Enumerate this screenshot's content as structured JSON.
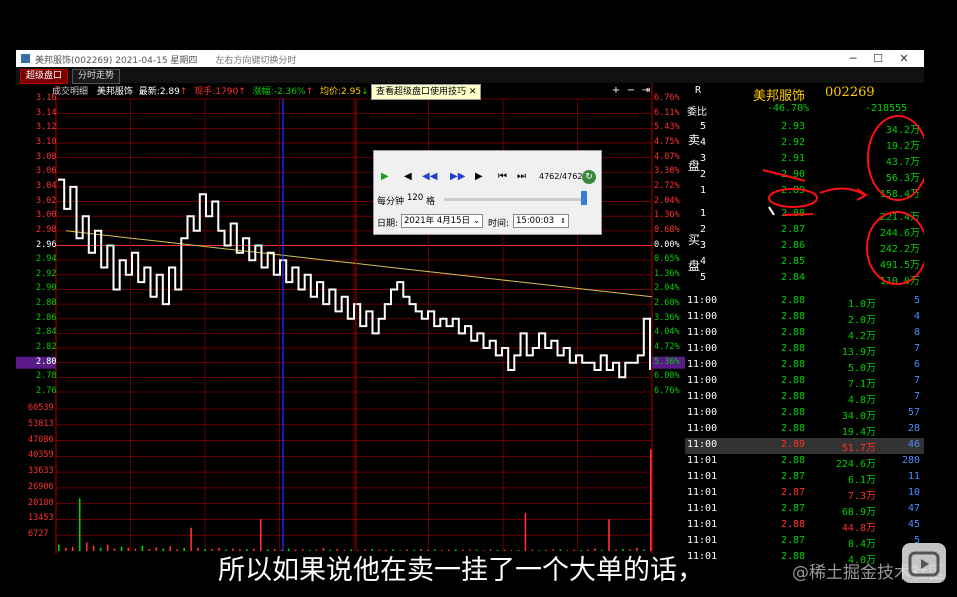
{
  "window": {
    "title": "美邦服饰(002269) 2021-04-15 星期四",
    "hint": "左右方向键切换分时",
    "min_label": "─",
    "max_label": "☐",
    "close_label": "✕"
  },
  "tabs": [
    {
      "label": "超级盘口",
      "active": true
    },
    {
      "label": "分时走势",
      "active": false
    }
  ],
  "chart_header": {
    "prefix": "成交明细",
    "name": "美邦服饰",
    "latest_label": "最新:",
    "latest": "2.89",
    "latest_arrow": "↑",
    "vol_label": "现手:",
    "vol": "1790",
    "vol_arrow": "↑",
    "change_label": "涨幅:",
    "change": "-2.36%",
    "change_arrow": "↑",
    "avg_label": "均价:",
    "avg": "2.95",
    "avg_arrow": "↓"
  },
  "tip_button": "查看超级盘口使用技巧",
  "tip_close": "✕",
  "toolbar_icons": [
    "plus-icon",
    "minus-icon",
    "pin-icon"
  ],
  "toolbar_glyphs": [
    "+",
    "−",
    "⇥"
  ],
  "chart_data": {
    "type": "line",
    "price_axis": [
      "3.16",
      "3.14",
      "3.12",
      "3.10",
      "3.08",
      "3.06",
      "3.04",
      "3.02",
      "3.00",
      "2.98",
      "2.96",
      "2.94",
      "2.92",
      "2.90",
      "2.88",
      "2.86",
      "2.84",
      "2.82",
      "2.80",
      "2.78",
      "2.76"
    ],
    "pct_axis": [
      "6.76%",
      "6.11%",
      "5.43%",
      "4.75%",
      "4.07%",
      "3.38%",
      "2.72%",
      "2.04%",
      "1.36%",
      "0.68%",
      "0.00%",
      "0.65%",
      "1.36%",
      "2.04%",
      "2.68%",
      "3.36%",
      "4.04%",
      "4.72%",
      "5.36%",
      "6.08%",
      "6.76%"
    ],
    "volume_axis": [
      "60539",
      "53813",
      "47086",
      "40359",
      "33633",
      "26906",
      "20180",
      "13453",
      "6727"
    ],
    "current_price_label": "2.80",
    "prev_close": 2.96,
    "price_series": [
      3.05,
      3.01,
      3.04,
      2.97,
      3.0,
      2.95,
      2.98,
      2.93,
      2.96,
      2.9,
      2.94,
      2.92,
      2.95,
      2.91,
      2.93,
      2.89,
      2.92,
      2.88,
      2.93,
      2.9,
      2.97,
      3.0,
      2.98,
      3.03,
      3.0,
      3.02,
      2.98,
      2.96,
      2.99,
      2.95,
      2.97,
      2.94,
      2.96,
      2.93,
      2.95,
      2.92,
      2.94,
      2.91,
      2.93,
      2.9,
      2.92,
      2.89,
      2.91,
      2.88,
      2.9,
      2.87,
      2.89,
      2.86,
      2.88,
      2.85,
      2.87,
      2.84,
      2.86,
      2.88,
      2.9,
      2.91,
      2.89,
      2.88,
      2.87,
      2.86,
      2.87,
      2.85,
      2.86,
      2.85,
      2.86,
      2.84,
      2.85,
      2.83,
      2.84,
      2.82,
      2.83,
      2.81,
      2.82,
      2.79,
      2.81,
      2.84,
      2.81,
      2.82,
      2.84,
      2.82,
      2.83,
      2.81,
      2.82,
      2.8,
      2.81,
      2.8,
      2.8,
      2.79,
      2.81,
      2.79,
      2.8,
      2.78,
      2.8,
      2.8,
      2.81,
      2.86,
      2.79
    ],
    "avg_series": [
      2.98,
      2.975,
      2.97,
      2.965,
      2.96,
      2.955,
      2.95,
      2.945,
      2.94,
      2.935,
      2.93,
      2.925,
      2.92,
      2.915,
      2.91,
      2.905,
      2.9,
      2.895,
      2.89
    ],
    "volume_series": [
      3000,
      1500,
      2000,
      25000,
      4000,
      2500,
      1500,
      3000,
      1200,
      2000,
      1500,
      1000,
      2500,
      900,
      1800,
      1200,
      2200,
      800,
      1500,
      11000,
      1400,
      1000,
      900,
      1600,
      700,
      1200,
      800,
      900,
      1000,
      15000,
      700,
      900,
      500,
      1200,
      600,
      800,
      500,
      700,
      1400,
      600,
      900,
      500,
      800,
      400,
      700,
      1000,
      600,
      500,
      800,
      400,
      700,
      600,
      900,
      500,
      700,
      400,
      600,
      800,
      500,
      700,
      600,
      400,
      700,
      500,
      600,
      400,
      500,
      18000,
      600,
      400,
      500,
      700,
      800,
      400,
      600,
      500,
      700,
      1200,
      500,
      15000,
      600,
      900,
      800,
      1600,
      700,
      48000
    ]
  },
  "replay": {
    "counter": "4762/4762",
    "speed_label": "每分钟",
    "speed_value": "120",
    "speed_unit": "格",
    "date_label": "日期:",
    "date_value": "2021年 4月15日",
    "time_label": "时间:",
    "time_value": "15:00:03",
    "progress": 1.0
  },
  "quote": {
    "r_label": "R",
    "stock_name": "美邦服饰",
    "code": "002269",
    "weibi_label": "委比",
    "weibi_pct": "-46.70%",
    "weibi_diff": "-218555",
    "sell_side_label": "卖盘",
    "buy_side_label": "买盘",
    "sell": [
      {
        "level": "5",
        "price": "2.93",
        "vol": "34.2万"
      },
      {
        "level": "4",
        "price": "2.92",
        "vol": "19.2万"
      },
      {
        "level": "3",
        "price": "2.91",
        "vol": "43.7万"
      },
      {
        "level": "2",
        "price": "2.90",
        "vol": "56.3万"
      },
      {
        "level": "1",
        "price": "2.89",
        "vol": "158.4万"
      }
    ],
    "buy": [
      {
        "level": "1",
        "price": "2.88",
        "vol": "221.4万"
      },
      {
        "level": "2",
        "price": "2.87",
        "vol": "244.6万"
      },
      {
        "level": "3",
        "price": "2.86",
        "vol": "242.2万"
      },
      {
        "level": "4",
        "price": "2.85",
        "vol": "491.5万"
      },
      {
        "level": "5",
        "price": "2.84",
        "vol": "110.0万"
      }
    ],
    "trades": [
      {
        "time": "11:00",
        "price": "2.88",
        "vol": "1.0万",
        "count": "5",
        "dir": "down"
      },
      {
        "time": "11:00",
        "price": "2.88",
        "vol": "2.0万",
        "count": "4",
        "dir": "down"
      },
      {
        "time": "11:00",
        "price": "2.88",
        "vol": "4.2万",
        "count": "8",
        "dir": "down"
      },
      {
        "time": "11:00",
        "price": "2.88",
        "vol": "13.9万",
        "count": "7",
        "dir": "down"
      },
      {
        "time": "11:00",
        "price": "2.88",
        "vol": "5.0万",
        "count": "6",
        "dir": "down"
      },
      {
        "time": "11:00",
        "price": "2.88",
        "vol": "7.1万",
        "count": "7",
        "dir": "down"
      },
      {
        "time": "11:00",
        "price": "2.88",
        "vol": "4.8万",
        "count": "7",
        "dir": "down"
      },
      {
        "time": "11:00",
        "price": "2.88",
        "vol": "34.0万",
        "count": "57",
        "dir": "down"
      },
      {
        "time": "11:00",
        "price": "2.88",
        "vol": "19.4万",
        "count": "28",
        "dir": "down"
      },
      {
        "time": "11:00",
        "price": "2.89",
        "vol": "51.7万",
        "count": "46",
        "dir": "up"
      },
      {
        "time": "11:01",
        "price": "2.88",
        "vol": "224.6万",
        "count": "280",
        "dir": "down"
      },
      {
        "time": "11:01",
        "price": "2.87",
        "vol": "6.1万",
        "count": "11",
        "dir": "down"
      },
      {
        "time": "11:01",
        "price": "2.87",
        "vol": "7.3万",
        "count": "10",
        "dir": "up"
      },
      {
        "time": "11:01",
        "price": "2.87",
        "vol": "68.9万",
        "count": "47",
        "dir": "down"
      },
      {
        "time": "11:01",
        "price": "2.88",
        "vol": "44.8万",
        "count": "45",
        "dir": "up"
      },
      {
        "time": "11:01",
        "price": "2.87",
        "vol": "8.4万",
        "count": "5",
        "dir": "down"
      },
      {
        "time": "11:01",
        "price": "2.88",
        "vol": "4.0万",
        "count": "5",
        "dir": "down"
      }
    ]
  },
  "subtitle": "所以如果说他在卖一挂了一个大单的话，",
  "watermark": "@稀土掘金技术社区",
  "colors": {
    "up": "#ff3030",
    "down": "#00d000",
    "grid": "#800000",
    "white": "#ffffff",
    "avg": "#d6c050",
    "accent": "#ffcc00",
    "cursor": "#3030ff",
    "annotation": "#ff1010"
  }
}
